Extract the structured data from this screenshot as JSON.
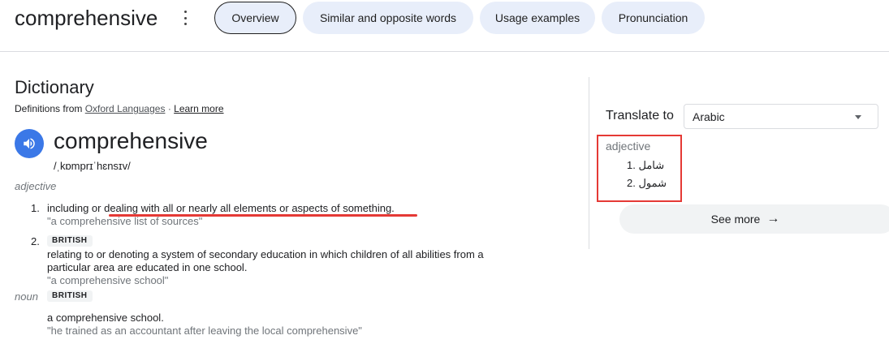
{
  "header": {
    "word": "comprehensive",
    "tabs": [
      {
        "label": "Overview"
      },
      {
        "label": "Similar and opposite words"
      },
      {
        "label": "Usage examples"
      },
      {
        "label": "Pronunciation"
      }
    ]
  },
  "dictionary": {
    "title": "Dictionary",
    "definitions_from_prefix": "Definitions from",
    "source": "Oxford Languages",
    "separator": "·",
    "learn_more": "Learn more",
    "headword": "comprehensive",
    "phonetic": "/ˌkɒmprɪˈhɛnsɪv/",
    "entries": [
      {
        "pos": "adjective",
        "senses": [
          {
            "number": "1.",
            "definition": "including or dealing with all or nearly all elements or aspects of something.",
            "example": "\"a comprehensive list of sources\""
          },
          {
            "number": "2.",
            "label": "BRITISH",
            "definition_line1": "relating to or denoting a system of secondary education in which children of all abilities from a",
            "definition_line2": "particular area are educated in one school.",
            "example": "\"a comprehensive school\""
          }
        ]
      },
      {
        "pos": "noun",
        "label": "BRITISH",
        "senses": [
          {
            "definition": "a comprehensive school.",
            "example": "\"he trained as an accountant after leaving the local comprehensive\""
          }
        ]
      }
    ]
  },
  "translate": {
    "label": "Translate to",
    "language": "Arabic",
    "pos": "adjective",
    "items": [
      {
        "number": "1.",
        "text": "شامل"
      },
      {
        "number": "2.",
        "text": "شمول"
      }
    ],
    "see_more": "See more",
    "arrow": "→"
  },
  "colors": {
    "accent": "#3b78e7",
    "highlight": "#e53935",
    "tab_bg": "#e8eefa"
  },
  "icons": [
    "more-vert-icon",
    "speaker-icon",
    "dropdown-caret-icon",
    "arrow-right-icon"
  ]
}
